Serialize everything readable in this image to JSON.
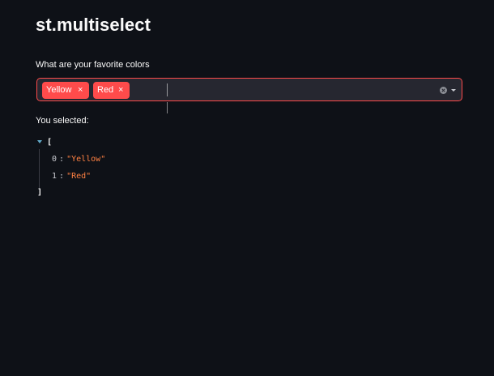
{
  "page": {
    "title": "st.multiselect"
  },
  "multiselect": {
    "label": "What are your favorite colors",
    "selected": [
      {
        "label": "Yellow",
        "remove": "×"
      },
      {
        "label": "Red",
        "remove": "×"
      }
    ],
    "icons": {
      "clear": "clear-icon",
      "dropdown": "chevron-down-icon"
    },
    "accent_color": "#ff4b4b"
  },
  "output": {
    "label": "You selected:",
    "json": {
      "open": "[",
      "close": "]",
      "items": [
        {
          "index": "0",
          "colon": ":",
          "value": "\"Yellow\""
        },
        {
          "index": "1",
          "colon": ":",
          "value": "\"Red\""
        }
      ]
    }
  },
  "colors": {
    "background": "#0e1117",
    "input_background": "#262730",
    "string_value": "#ff8142",
    "toggle": "#62a9c8"
  }
}
